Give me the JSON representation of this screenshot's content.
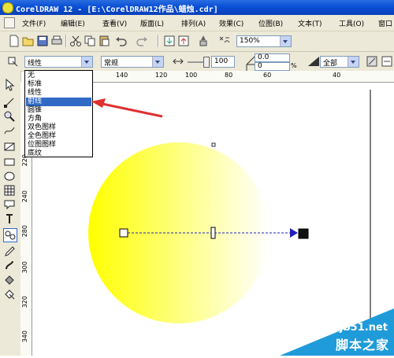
{
  "window": {
    "title": "CorelDRAW 12 - [E:\\CorelDRAW12作品\\蜡烛.cdr]"
  },
  "menu": {
    "items": [
      {
        "label": "文件(F)"
      },
      {
        "label": "编辑(E)"
      },
      {
        "label": "查看(V)"
      },
      {
        "label": "版面(L)"
      },
      {
        "label": "排列(A)"
      },
      {
        "label": "效果(C)"
      },
      {
        "label": "位图(B)"
      },
      {
        "label": "文本(T)"
      },
      {
        "label": "工具(O)"
      },
      {
        "label": "窗口"
      }
    ]
  },
  "toolbar": {
    "zoom_value": "150%"
  },
  "propertybar": {
    "fill_type": "线性",
    "blend_mode": "常规",
    "midpoint_value": "100",
    "angle_value": "0.0",
    "edge_pad_value": "0",
    "edge_pad_unit": "%",
    "scope": "全部"
  },
  "dropdown": {
    "items": [
      "无",
      "标准",
      "线性",
      "射线",
      "圆锥",
      "方角",
      "双色图样",
      "全色图样",
      "位图图样",
      "底纹"
    ],
    "selected_index": 3
  },
  "ruler": {
    "h_labels": [
      "140",
      "120",
      "100",
      "80",
      "60",
      "40"
    ],
    "v_labels": [
      "220",
      "240",
      "260",
      "280",
      "300",
      "320",
      "340"
    ]
  },
  "watermark": {
    "site": "jb51.net",
    "name": "脚本之家"
  },
  "colors": {
    "gradient_start": "#ffff00",
    "gradient_end": "#ffffff",
    "selection": "#316ac5",
    "arrow_annotation": "#e03030",
    "vector_line": "#2020c0",
    "watermark_bg": "#1f9bd9"
  }
}
